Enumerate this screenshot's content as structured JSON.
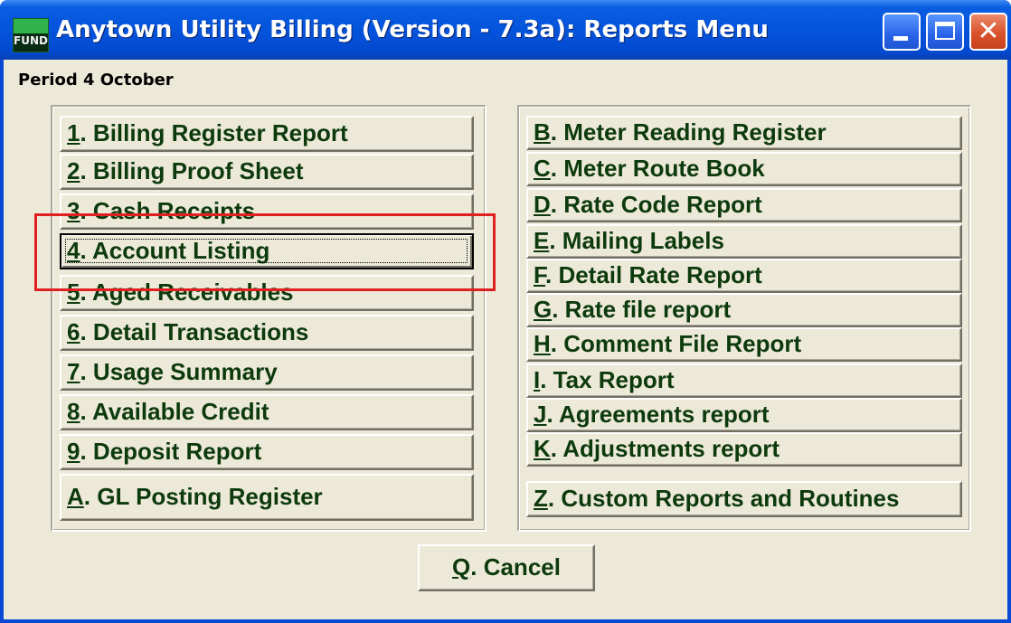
{
  "window": {
    "title": "Anytown Utility Billing (Version - 7.3a):  Reports Menu",
    "icon_label": "FUND",
    "controls": [
      "minimize-icon",
      "maximize-icon",
      "close-icon"
    ]
  },
  "period_label": "Period 4 October",
  "left_buttons": [
    {
      "key": "1",
      "rest": ". Billing Register Report"
    },
    {
      "key": "2",
      "rest": ".  Billing Proof Sheet"
    },
    {
      "key": "3",
      "rest": ". Cash Receipts"
    },
    {
      "key": "4",
      "rest": ". Account Listing",
      "focused": true
    },
    {
      "key": "5",
      "rest": ". Aged Receivables"
    },
    {
      "key": "6",
      "rest": ". Detail Transactions"
    },
    {
      "key": "7",
      "rest": ". Usage Summary"
    },
    {
      "key": "8",
      "rest": ". Available Credit"
    },
    {
      "key": "9",
      "rest": ".  Deposit Report"
    },
    {
      "key": "A",
      "rest": ". GL Posting Register"
    }
  ],
  "right_buttons": [
    {
      "key": "B",
      "rest": ". Meter Reading Register"
    },
    {
      "key": "C",
      "rest": ". Meter Route Book"
    },
    {
      "key": "D",
      "rest": ".  Rate Code Report"
    },
    {
      "key": "E",
      "rest": ". Mailing Labels"
    },
    {
      "key": "F",
      "rest": ". Detail Rate Report"
    },
    {
      "key": "G",
      "rest": ". Rate file report"
    },
    {
      "key": "H",
      "rest": ".  Comment File Report"
    },
    {
      "key": "I",
      "rest": ". Tax Report"
    },
    {
      "key": "J",
      "rest": ". Agreements report"
    },
    {
      "key": "K",
      "rest": ". Adjustments report"
    },
    {
      "key": "Z",
      "rest": ".  Custom Reports and Routines"
    }
  ],
  "cancel_button": {
    "key": "Q",
    "rest": ". Cancel"
  },
  "colors": {
    "accent": "#0a49d4",
    "button_text": "#0d3a0d",
    "highlight": "#e02020",
    "face": "#ece9d8"
  }
}
